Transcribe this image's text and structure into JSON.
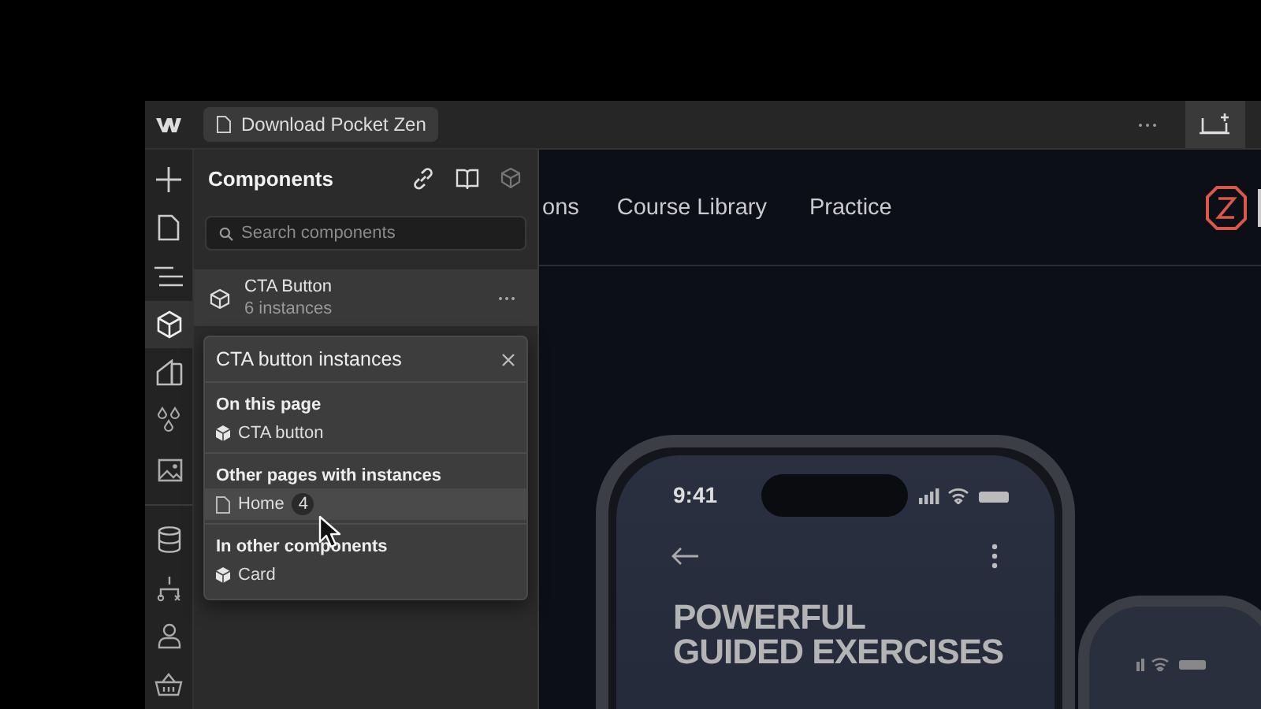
{
  "top_bar": {
    "page_button": {
      "label": "Download Pocket Zen"
    },
    "preview_button": {
      "active": true
    }
  },
  "rail": [
    {
      "kind": "add",
      "selected": false
    },
    {
      "kind": "pages",
      "selected": false
    },
    {
      "kind": "navigator",
      "selected": false
    },
    {
      "kind": "components",
      "selected": true
    },
    {
      "kind": "styles",
      "selected": false
    },
    {
      "kind": "variables",
      "selected": false
    },
    {
      "kind": "assets",
      "selected": false
    },
    {
      "kind": "cms",
      "selected": false
    },
    {
      "kind": "logic",
      "selected": false
    },
    {
      "kind": "users",
      "selected": false
    },
    {
      "kind": "ecommerce",
      "selected": false
    }
  ],
  "panel": {
    "title": "Components",
    "search": {
      "placeholder": "Search components"
    },
    "items": [
      {
        "name": "CTA Button",
        "instances": "6 instances",
        "selected": true
      }
    ]
  },
  "popover": {
    "title": "CTA button instances",
    "sections": [
      {
        "heading": "On this page",
        "items": [
          {
            "kind": "component",
            "label": "CTA button",
            "highlighted": false
          }
        ]
      },
      {
        "heading": "Other pages with instances",
        "items": [
          {
            "kind": "page",
            "label": "Home",
            "count": "4",
            "highlighted": true
          }
        ]
      },
      {
        "heading": "In other components",
        "items": [
          {
            "kind": "component",
            "label": "Card",
            "highlighted": false
          }
        ]
      }
    ]
  },
  "canvas": {
    "nav": [
      "ons",
      "Course Library",
      "Practice"
    ],
    "phone": {
      "time": "9:41",
      "headline": "POWERFUL\nGUIDED EXERCISES"
    }
  }
}
